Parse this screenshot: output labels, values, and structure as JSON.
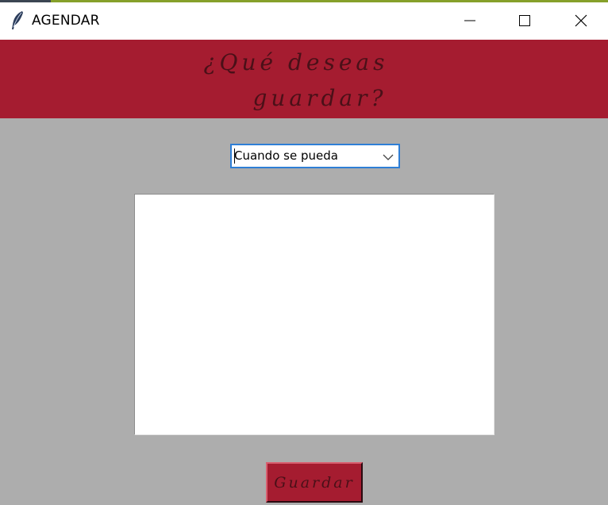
{
  "window": {
    "title": "AGENDAR",
    "controls": {
      "minimize": "minimize-icon",
      "maximize": "maximize-icon",
      "close": "close-icon"
    }
  },
  "header": {
    "line1": "¿Qué deseas",
    "line2": "guardar?",
    "background": "#a51c30",
    "text_color": "#4a1018"
  },
  "priority_select": {
    "value": "Cuando se pueda",
    "icon": "chevron-down-icon"
  },
  "note_textarea": {
    "value": ""
  },
  "save_button": {
    "label": "Guardar"
  },
  "colors": {
    "background": "#adadad",
    "accent": "#a51c30",
    "focus_border": "#2f7fd6"
  }
}
